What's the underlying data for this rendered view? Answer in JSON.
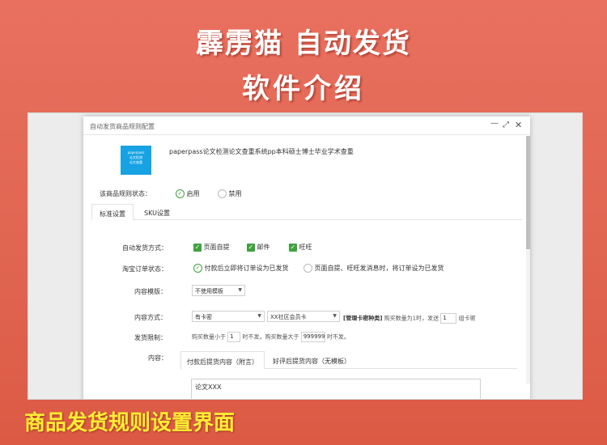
{
  "banner": {
    "title": "霹雳猫 自动发货",
    "subtitle": "软件介绍",
    "caption": "商品发货规则设置界面"
  },
  "dialog": {
    "title": "自动发货商品规则配置",
    "controls": {
      "minimize": "—",
      "maximize": "⤢",
      "close": "✕"
    },
    "product": {
      "image_text": [
        "paperpass",
        "论文检测",
        "论文查重"
      ],
      "name": "paperpass论文检测论文查重系统pp本科硕士博士毕业学术查重"
    },
    "rule_status": {
      "label": "该商品规则状态：",
      "options": [
        {
          "label": "启用",
          "selected": true
        },
        {
          "label": "禁用",
          "selected": false
        }
      ]
    },
    "tabs": [
      {
        "label": "标准设置",
        "active": true
      },
      {
        "label": "SKU设置",
        "active": false
      }
    ],
    "auto_ship": {
      "label": "自动发货方式：",
      "options": [
        {
          "label": "页面自提",
          "checked": true
        },
        {
          "label": "邮件",
          "checked": true
        },
        {
          "label": "旺旺",
          "checked": true
        }
      ]
    },
    "order_status": {
      "label": "淘宝订单状态：",
      "options": [
        {
          "label": "付款后立即将订单设为已发货",
          "selected": true
        },
        {
          "label": "页面自提、旺旺发消息时，将订单设为已发货",
          "selected": false
        }
      ]
    },
    "content_template": {
      "label": "内容模版：",
      "value": "不使用模板"
    },
    "content_method": {
      "label": "内容方式：",
      "select1": "有卡密",
      "select2": "XX社区会员卡",
      "tag": "[管理卡密种类]",
      "text_before": "购买数量为1时，发送",
      "count": "1",
      "text_after": "组卡密"
    },
    "ship_limit": {
      "label": "发货限制：",
      "text1": "购买数量小于",
      "min": "1",
      "text2": "时不发。购买数量大于",
      "max": "999999",
      "text3": "时不发。"
    },
    "content": {
      "label": "内容：",
      "tabs": [
        {
          "label": "付款后提货内容（附言）",
          "active": true
        },
        {
          "label": "好评后提货内容（无模板）",
          "active": false
        }
      ],
      "value": "论文XXX"
    }
  },
  "colors": {
    "background": "#e06652",
    "caption": "#ffee33",
    "check": "#3ea33e",
    "product_image": "#17a3e3"
  }
}
